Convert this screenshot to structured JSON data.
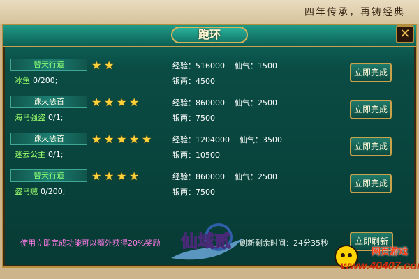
{
  "banner": {
    "slogan": "四年传承，再铸经典"
  },
  "window": {
    "title": "跑环",
    "close_symbol": "✕"
  },
  "labels": {
    "exp": "经验：",
    "xianqi": "仙气：",
    "silver": "银两："
  },
  "quests": [
    {
      "type": "替天行道",
      "type_color": "green",
      "target": "冰鱼",
      "progress": "0/200;",
      "stars": 2,
      "exp": "516000",
      "xianqi": "1500",
      "silver": "4500",
      "button": "立即完成"
    },
    {
      "type": "诛灭恶首",
      "type_color": "white",
      "target": "海马强盗",
      "progress": "0/1;",
      "stars": 4,
      "exp": "860000",
      "xianqi": "2500",
      "silver": "7500",
      "button": "立即完成"
    },
    {
      "type": "诛灭恶首",
      "type_color": "white",
      "target": "迷云公主",
      "progress": "0/1;",
      "stars": 5,
      "exp": "1204000",
      "xianqi": "3500",
      "silver": "10500",
      "button": "立即完成"
    },
    {
      "type": "替天行道",
      "type_color": "green",
      "target": "盗马贼",
      "progress": "0/200;",
      "stars": 4,
      "exp": "860000",
      "xianqi": "2500",
      "silver": "7500",
      "button": "立即完成"
    }
  ],
  "footer": {
    "note": "使用立即完成功能可以额外获得20%奖励",
    "timer": "刷新剩余时间：24分35秒",
    "refresh_button": "立即刷新"
  },
  "logo": {
    "text": "仙域贰"
  },
  "site": {
    "title": "网页游戏",
    "url": "www.40407.com"
  },
  "colors": {
    "frame": "#0a4c44",
    "gold": "#c9a24a",
    "star": "#ffd23c",
    "note": "#ff7ae8"
  }
}
